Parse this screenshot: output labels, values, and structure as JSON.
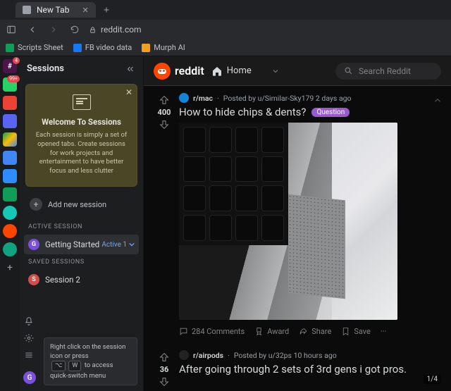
{
  "browser": {
    "tab_title": "New Tab",
    "url": "reddit.com",
    "bookmarks": [
      {
        "label": "Scripts Sheet",
        "color": "#0f9d58"
      },
      {
        "label": "FB video data",
        "color": "#1877f2"
      },
      {
        "label": "Murph AI",
        "color": "#f0a020"
      }
    ]
  },
  "rail_badges": {
    "slack": "4",
    "whatsapp": "99+"
  },
  "sessions": {
    "title": "Sessions",
    "welcome": {
      "title": "Welcome To Sessions",
      "body": "Each session is simply a set of opened tabs. Create sessions for work projects and entertainment to have better focus and less clutter"
    },
    "add_label": "Add new session",
    "active_label": "ACTIVE SESSION",
    "active": {
      "initial": "G",
      "name": "Getting Started",
      "status": "Active 1"
    },
    "saved_label": "SAVED SESSIONS",
    "saved": {
      "initial": "S",
      "name": "Session 2"
    },
    "hint_prefix": "Right click on the session icon or press",
    "hint_key1": "⌥",
    "hint_key2": "W",
    "hint_suffix": "to access quick-switch menu",
    "user_initial": "G"
  },
  "reddit": {
    "brand": "reddit",
    "home_label": "Home",
    "search_placeholder": "Search Reddit",
    "image_counter": "1/4",
    "posts": [
      {
        "sub": "r/mac",
        "byline": "Posted by u/Similar-Sky179 2 days ago",
        "title": "How to hide chips & dents?",
        "flair": "Question",
        "score": "400",
        "comments": "284 Comments",
        "award": "Award",
        "share": "Share",
        "save": "Save"
      },
      {
        "sub": "r/airpods",
        "byline": "Posted by u/32ps 10 hours ago",
        "title": "After going through 2 sets of 3rd gens i got pros.",
        "score": "36"
      }
    ]
  }
}
